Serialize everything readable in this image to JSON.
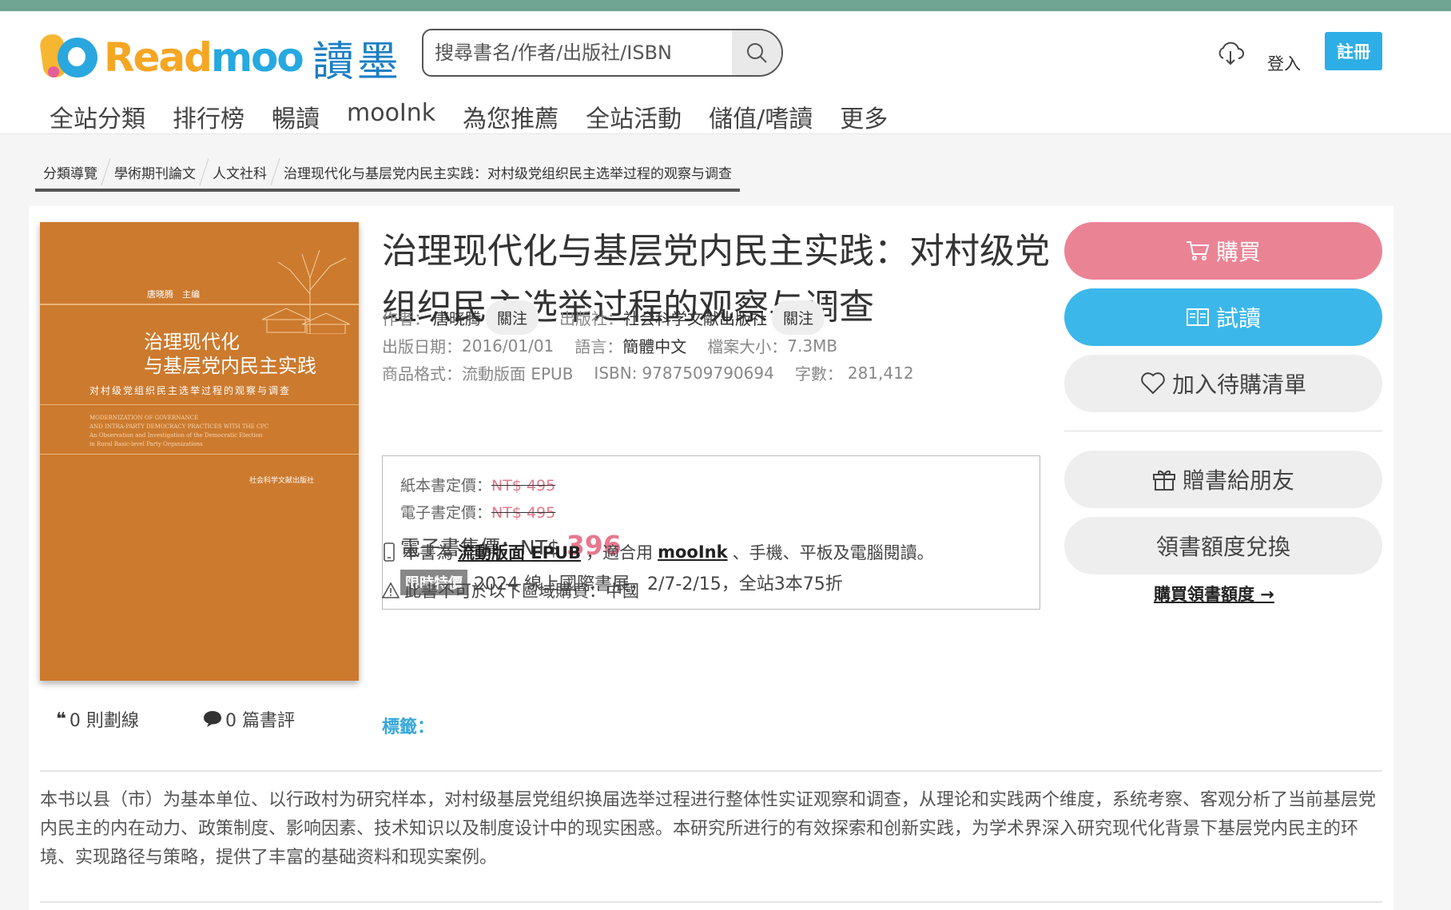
{
  "header": {
    "logo_text_a": "Read",
    "logo_text_b": "moo",
    "logo_cn": "讀墨",
    "search_placeholder": "搜尋書名/作者/出版社/ISBN",
    "login": "登入",
    "register": "註冊"
  },
  "nav": [
    "全站分類",
    "排行榜",
    "暢讀",
    "mooInk",
    "為您推薦",
    "全站活動",
    "儲值/嗜讀",
    "更多"
  ],
  "breadcrumb": [
    "分類導覽",
    "學術期刊論文",
    "人文社科",
    "治理现代化与基层党内民主实践：对村级党组织民主选举过程的观察与调查"
  ],
  "cover": {
    "editor": "唐晓腾　主编",
    "title_line1": "治理现代化",
    "title_line2": "与基层党内民主实践",
    "subtitle": "对村级党组织民主选举过程的观察与调查",
    "en_line1": "MODERNIZATION OF GOVERNANCE",
    "en_line2": "AND INTRA-PARTY DEMOCRACY PRACTICES WITH THE CPC",
    "en_line3": "An Observation and Investigation of the Democratic Election",
    "en_line4": "in Rural Basic-level Party Organizations",
    "publisher": "社会科学文献出版社"
  },
  "stats": {
    "highlights": "0 則劃線",
    "reviews": "0 篇書評"
  },
  "book": {
    "title": "治理现代化与基层党内民主实践：对村级党组织民主选举过程的观察与调查",
    "author_label": "作者：",
    "author": "唐晓腾",
    "follow": "關注",
    "publisher_label": "出版社：",
    "publisher": "社会科学文献出版社",
    "pubdate_label": "出版日期：",
    "pubdate": "2016/01/01",
    "lang_label": "語言：",
    "lang": "簡體中文",
    "size_label": "檔案大小：",
    "size": "7.3MB",
    "format_label": "商品格式：",
    "format": "流動版面 EPUB",
    "isbn_label": "ISBN:",
    "isbn": "9787509790694",
    "words_label": "字數：",
    "words": "281,412"
  },
  "price": {
    "paper_label": "紙本書定價：",
    "paper_price": "NT$ 495",
    "ebook_label": "電子書定價：",
    "ebook_price": "NT$ 495",
    "sale_label": "電子書售價：NT$",
    "sale_price": "396",
    "promo_badge": "限時特價",
    "promo_text": "2024 線上國際書展，2/7-2/15，全站3本75折"
  },
  "info": {
    "format_pre": "本書為",
    "format_link": "流動版面 EPUB",
    "format_mid": "，適合用",
    "device_link": "mooInk",
    "format_post": "、手機、平板及電腦閱讀。",
    "region": "此書不可於以下區域購買：中國",
    "tags_label": "標籤："
  },
  "actions": {
    "buy": "購買",
    "try": "試讀",
    "wishlist": "加入待購清單",
    "gift": "贈書給朋友",
    "redeem": "領書額度兌換",
    "quota_link": "購買領書額度 →"
  },
  "description": "本书以县（市）为基本单位、以行政村为研究样本，对村级基层党组织换届选举过程进行整体性实证观察和调查，从理论和实践两个维度，系统考察、客观分析了当前基层党内民主的内在动力、政策制度、影响因素、技术知识以及制度设计中的现实困惑。本研究所进行的有效探索和创新实践，为学术界深入研究现代化背景下基层党内民主的环境、实现路径与策略，提供了丰富的基础资料和现实案例。",
  "colors": {
    "accent_top": "#6fa592",
    "buy": "#ea8495",
    "try": "#3cb7ea",
    "register": "#2eaee6",
    "sale_price": "#e8788f",
    "cover": "#cc7a2e"
  }
}
